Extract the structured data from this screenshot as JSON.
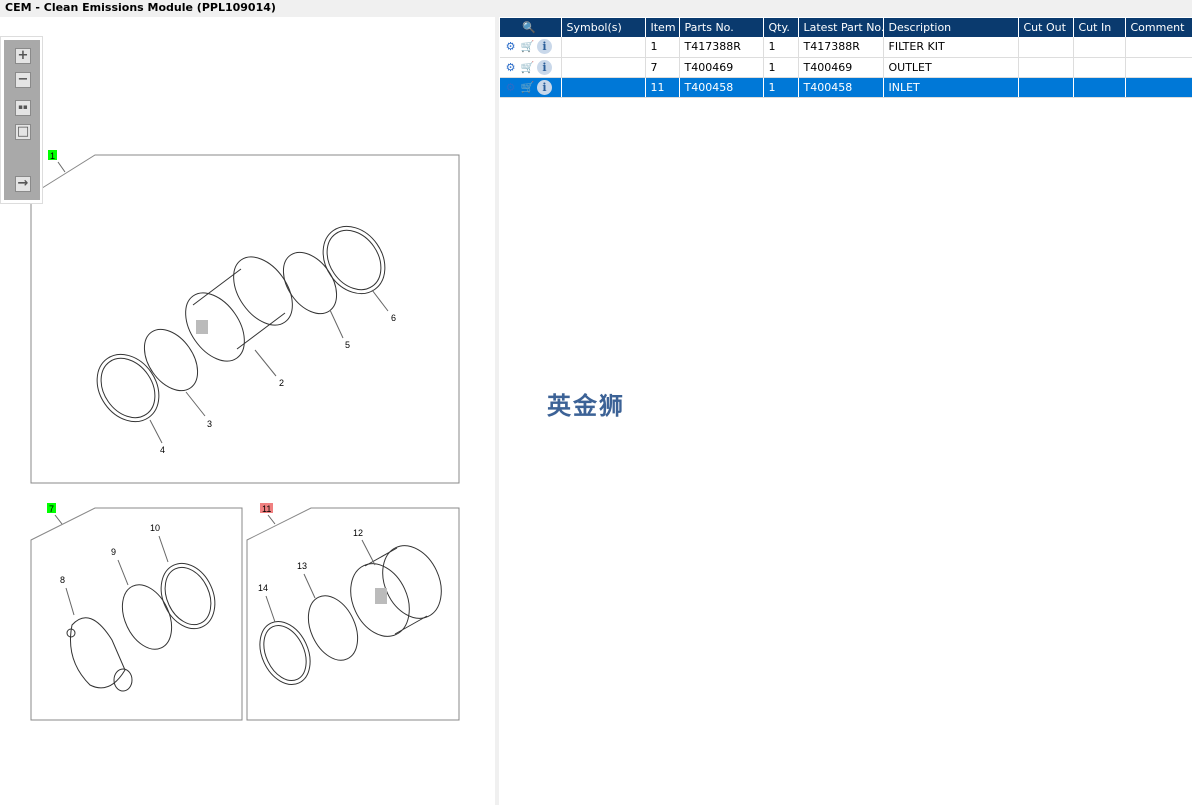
{
  "title": "CEM - Clean Emissions Module (PPL109014)",
  "toolbar": {
    "buttons": [
      "zoom-in",
      "zoom-out",
      "fit-all",
      "fit-window",
      "toggle-layout"
    ],
    "glyphs": {
      "zoom_in": "+",
      "zoom_out": "−",
      "fit_all": "▪▪",
      "fit_window": "□",
      "toggle": "→"
    }
  },
  "diagram": {
    "groups": [
      {
        "label": "1",
        "color": "#00ff00"
      },
      {
        "label": "7",
        "color": "#00ff00"
      },
      {
        "label": "11",
        "color": "#f08080"
      }
    ],
    "callouts": [
      "2",
      "3",
      "4",
      "5",
      "6",
      "8",
      "9",
      "10",
      "12",
      "13",
      "14"
    ]
  },
  "grid": {
    "columns": [
      "",
      "Symbol(s)",
      "Item",
      "Parts No.",
      "Qty.",
      "Latest Part No.",
      "Description",
      "Cut Out",
      "Cut In",
      "Comment"
    ],
    "rows": [
      {
        "symbols": "",
        "item": "1",
        "parts_no": "T417388R",
        "qty": "1",
        "latest": "T417388R",
        "description": "FILTER KIT",
        "cut_out": "",
        "cut_in": "",
        "comment": "",
        "selected": false
      },
      {
        "symbols": "",
        "item": "7",
        "parts_no": "T400469",
        "qty": "1",
        "latest": "T400469",
        "description": "OUTLET",
        "cut_out": "",
        "cut_in": "",
        "comment": "",
        "selected": false
      },
      {
        "symbols": "",
        "item": "11",
        "parts_no": "T400458",
        "qty": "1",
        "latest": "T400458",
        "description": "INLET",
        "cut_out": "",
        "cut_in": "",
        "comment": "",
        "selected": true
      }
    ],
    "icons": {
      "gear": "⚙",
      "cart": "🛒",
      "info": "i",
      "search": "🔍"
    }
  },
  "watermark": "英金狮",
  "colors": {
    "header": "#0a3a6e",
    "selection": "#0078d7"
  }
}
